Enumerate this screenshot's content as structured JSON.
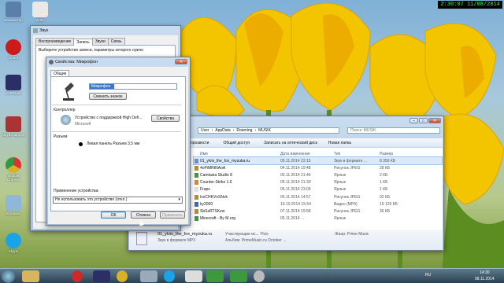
{
  "overlay_clock": "2:30:07  11/08/2014",
  "desktop_icons": [
    {
      "label": "Компьютер",
      "icon": "computer-icon",
      "color": "#5a7fa8"
    },
    {
      "label": "Video",
      "icon": "camera-icon",
      "color": "#e9e9e9"
    },
    {
      "label": "Opera",
      "icon": "opera-icon",
      "color": "#cc1b1b"
    },
    {
      "label": "KMPlayer",
      "icon": "kmplayer-icon",
      "color": "#2b2f66"
    },
    {
      "label": "Naya Diagram",
      "icon": "ninja-icon",
      "color": "#a33"
    },
    {
      "label": "Google Chrome",
      "icon": "chrome-icon",
      "color": "#d9b02a"
    },
    {
      "label": "Корзина",
      "icon": "recycle-bin-icon",
      "color": "#8fb8d8"
    },
    {
      "label": "Skype",
      "icon": "skype-icon",
      "color": "#1aa3e6"
    }
  ],
  "sound_dialog": {
    "title": "Звук",
    "tabs": [
      "Воспроизведение",
      "Запись",
      "Звуки",
      "Связь"
    ],
    "instruction": "Выберите устройство записи, параметры которого нужно"
  },
  "mic_dialog": {
    "title": "Свойства: Микрофон",
    "tabs": [
      "Общие"
    ],
    "name_value": "Микрофон",
    "change_icon_button": "Сменить значок",
    "controller_label": "Контроллер",
    "controller_device": "Устройство с поддержкой High Defi...",
    "controller_vendor": "Microsoft",
    "properties_button": "Свойства",
    "jack_label": "Разъем",
    "jack_value": "Левая панель Разъем 3,5 мм",
    "usage_label": "Применение устройства:",
    "usage_value": "Не использовать это устройство (откл.)",
    "ok_button": "ОК",
    "cancel_button": "Отмена",
    "apply_button": "Применить"
  },
  "explorer": {
    "breadcrumb": [
      "User",
      "AppData",
      "Roaming",
      "MUSIK"
    ],
    "search_placeholder": "Поиск: MUSIK",
    "toolbar": [
      "прозвести",
      "Общий доступ",
      "Записать на оптический диск",
      "Новая папка"
    ],
    "columns": [
      "Имя",
      "Дата изменения",
      "Тип",
      "Размер"
    ],
    "rows": [
      {
        "name": "01_ylvis_the_fox_myzuka.ru",
        "date": "05.11.2014 22:15",
        "type": "Звук в формате ...",
        "size": "8 356 КБ"
      },
      {
        "name": "4oPiMRtNAoA",
        "date": "04.11.2014 19:48",
        "type": "Рисунок JPEG",
        "size": "28 КБ"
      },
      {
        "name": "Camtasia Studio 8",
        "date": "05.11.2014 21:46",
        "type": "Ярлык",
        "size": "2 КБ"
      },
      {
        "name": "Counter-Strike 1.6",
        "date": "05.11.2014 21:30",
        "type": "Ярлык",
        "size": "1 КБ"
      },
      {
        "name": "Fraps",
        "date": "05.11.2014 23:09",
        "type": "Ярлык",
        "size": "1 КБ"
      },
      {
        "name": "IxxCHKVnSNvk",
        "date": "05.11.2014 14:57",
        "type": "Рисунок JPEG",
        "size": "92 КБ"
      },
      {
        "name": "ky2000",
        "date": "19.10.2014 15:54",
        "type": "Видео (MP4)",
        "size": "19 129 КБ"
      },
      {
        "name": "SbSsRTSKzw",
        "date": "07.11.2014 19:58",
        "type": "Рисунок JPEG",
        "size": "36 КБ"
      },
      {
        "name": "Minecraft - By M.org",
        "date": "05.11.2014 ...",
        "type": "Ярлык",
        "size": ""
      }
    ],
    "details": {
      "name": "01_ylvis_the_fox_myzuka.ru",
      "type": "Звук в формате MP3",
      "participants": "Участвующие ис...  Ylvis",
      "album": "Альбом: PrimeMusic.ru October ...",
      "genre": "Жанр: Prime Music"
    }
  },
  "taskbar": {
    "lang": "RU",
    "time": "14:30",
    "date": "08.11.2014"
  }
}
